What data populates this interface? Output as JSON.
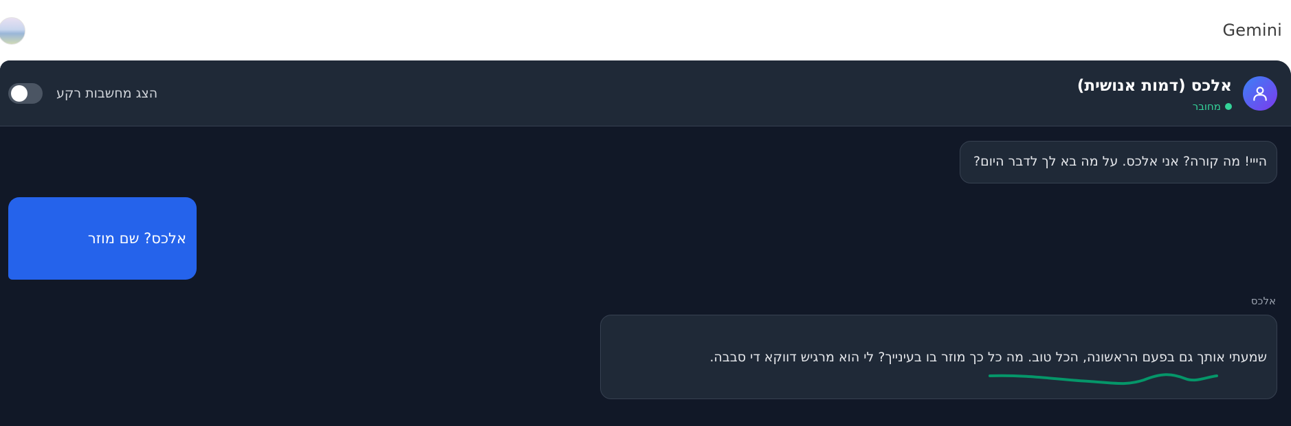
{
  "topbar": {
    "brand": "Gemini"
  },
  "header": {
    "agent_name": "אלכס (דמות אנושית)",
    "status": "מחובר",
    "toggle_label": "הצג מחשבות רקע",
    "toggle_on": false
  },
  "messages": [
    {
      "sender": "agent",
      "text": "הייי! מה קורה? אני אלכס. על מה בא לך לדבר היום?"
    },
    {
      "sender": "user",
      "text": "אלכס? שם מוזר"
    },
    {
      "sender": "agent",
      "sender_label": "אלכס",
      "text": "שמעתי אותך גם בפעם הראשונה, הכל טוב. מה כל כך מוזר בו בעינייך? לי הוא מרגיש דווקא די סבבה."
    }
  ],
  "colors": {
    "background": "#111827",
    "header": "#1f2937",
    "user_bubble": "#2563eb",
    "status": "#34d399",
    "scribble": "#059669"
  }
}
